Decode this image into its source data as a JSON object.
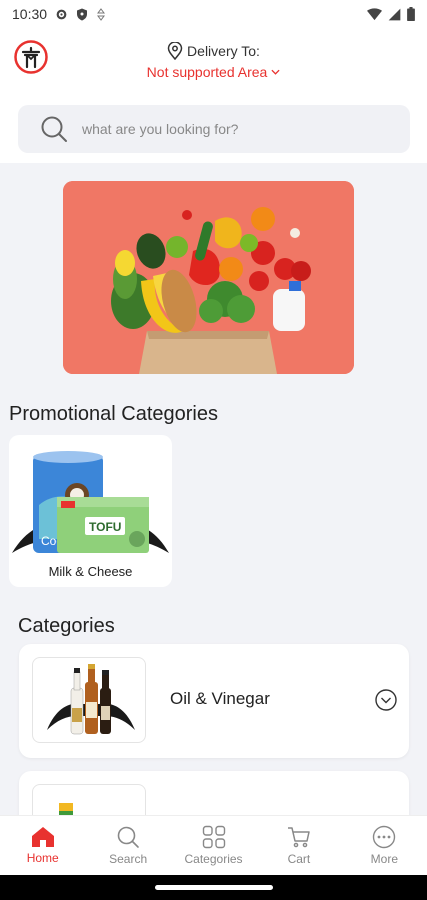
{
  "status_bar": {
    "time": "10:30"
  },
  "header": {
    "delivery_label": "Delivery To:",
    "delivery_area": "Not supported Area"
  },
  "search": {
    "placeholder": "what are you looking for?"
  },
  "promotional": {
    "title": "Promotional Categories",
    "items": [
      {
        "label": "Milk & Cheese"
      }
    ]
  },
  "categories": {
    "title": "Categories",
    "items": [
      {
        "label": "Oil & Vinegar"
      },
      {
        "label": ""
      }
    ]
  },
  "bottom_nav": {
    "items": [
      {
        "label": "Home",
        "icon": "home-icon",
        "active": true
      },
      {
        "label": "Search",
        "icon": "search-icon"
      },
      {
        "label": "Categories",
        "icon": "grid-icon"
      },
      {
        "label": "Cart",
        "icon": "cart-icon"
      },
      {
        "label": "More",
        "icon": "more-icon"
      }
    ]
  },
  "colors": {
    "accent": "#e8322f",
    "background": "#f2f3f7",
    "banner": "#f07765"
  }
}
